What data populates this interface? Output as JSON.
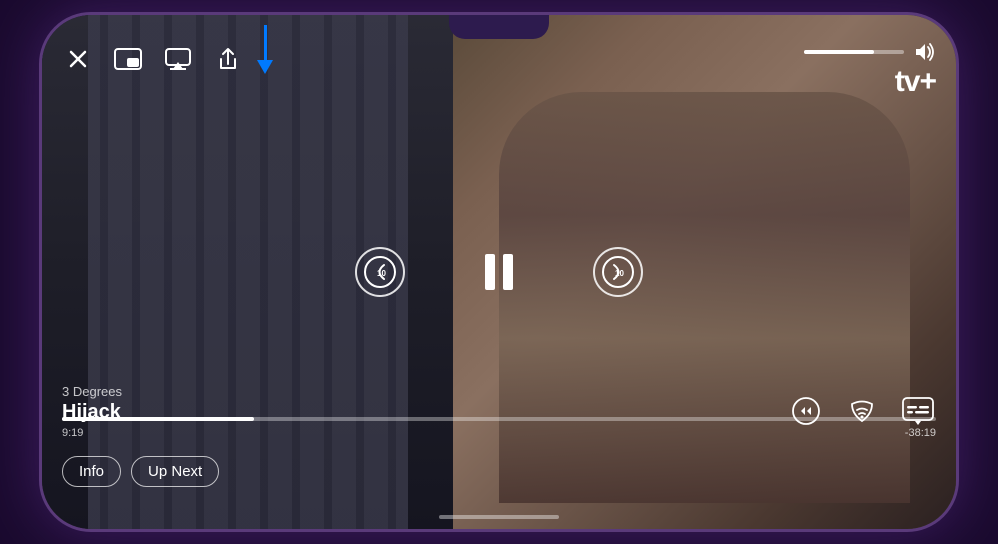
{
  "phone": {
    "notch": true
  },
  "arrow": {
    "color": "#007AFF"
  },
  "topBar": {
    "close_label": "✕",
    "icon1_name": "picture-in-picture-icon",
    "icon2_name": "airplay-icon",
    "icon3_name": "share-icon"
  },
  "volumeBar": {
    "fill_percent": 70,
    "icon": "🔊"
  },
  "appletv": {
    "logo": "tv+",
    "apple_symbol": ""
  },
  "centerControls": {
    "skip_back_seconds": "10",
    "skip_forward_seconds": "10",
    "pause_label": "pause"
  },
  "titleArea": {
    "show_name": "3 Degrees",
    "episode_title": "Hijack"
  },
  "progress": {
    "current_time": "9:19",
    "remaining_time": "-38:19",
    "fill_percent": 22
  },
  "bottomBar": {
    "info_label": "Info",
    "up_next_label": "Up Next"
  },
  "bottomRightIcons": {
    "icon1_name": "playback-speed-icon",
    "icon2_name": "audio-track-icon",
    "icon3_name": "subtitles-icon"
  }
}
